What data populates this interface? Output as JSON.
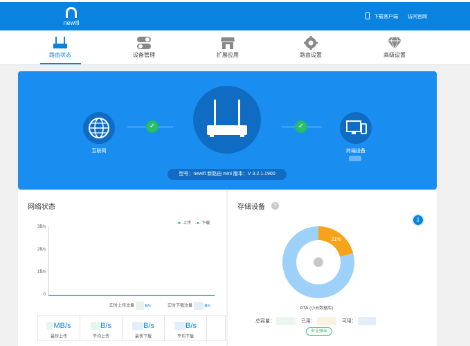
{
  "header": {
    "logo_text": "newifi",
    "download_client": "下载客户端",
    "visit_official": "访问官网"
  },
  "nav": {
    "items": [
      {
        "label": "路由状态",
        "icon": "router-icon",
        "active": true
      },
      {
        "label": "设备管理",
        "icon": "toggle-icon",
        "active": false
      },
      {
        "label": "扩展应用",
        "icon": "store-icon",
        "active": false
      },
      {
        "label": "路由设置",
        "icon": "gear-icon",
        "active": false
      },
      {
        "label": "高级设置",
        "icon": "diamond-icon",
        "active": false
      }
    ]
  },
  "hero": {
    "internet_label": "互联网",
    "devices_label": "终端设备",
    "model_info": "型号：newifi 新路由 mini    版本：V 3.2.1.1900",
    "colors": {
      "background": "#1a8ef0",
      "circle": "#0f6cc2",
      "ok": "#2fba6c"
    }
  },
  "network": {
    "title": "网络状态",
    "legend_upload": "上传",
    "legend_download": "下载",
    "y_ticks": [
      "3B/s",
      "2B/s",
      "1B/s",
      "0"
    ],
    "realtime_upload_label": "实时上传流量",
    "realtime_upload_value": "B/s",
    "realtime_download_label": "实时下载流量",
    "realtime_download_value": "B/s",
    "stats": [
      {
        "value": "MB/s",
        "label": "最快上传"
      },
      {
        "value": "B/s",
        "label": "平均上传"
      },
      {
        "value": "B/s",
        "label": "最快下载"
      },
      {
        "value": "B/s",
        "label": "平均下载"
      }
    ]
  },
  "chart_data": {
    "type": "line",
    "ylim": [
      0,
      3
    ],
    "y_ticks": [
      "3B/s",
      "2B/s",
      "1B/s",
      "0"
    ],
    "series": [
      {
        "name": "上传",
        "values": [
          0,
          0
        ],
        "color": "#3cbf6a"
      },
      {
        "name": "下载",
        "values": [
          0,
          0
        ],
        "color": "#2a7ad5"
      }
    ]
  },
  "storage": {
    "title": "存储设备",
    "help": "?",
    "used_percent": 21,
    "used_percent_label": "21%",
    "device_name": "ATA",
    "device_note": "(小云数据库)",
    "total_label": "总容量：",
    "used_label": "已用：",
    "available_label": "可用：",
    "eject_label": "安全弹出",
    "colors": {
      "used": "#f5a31a",
      "free": "#9dd1f9"
    }
  }
}
